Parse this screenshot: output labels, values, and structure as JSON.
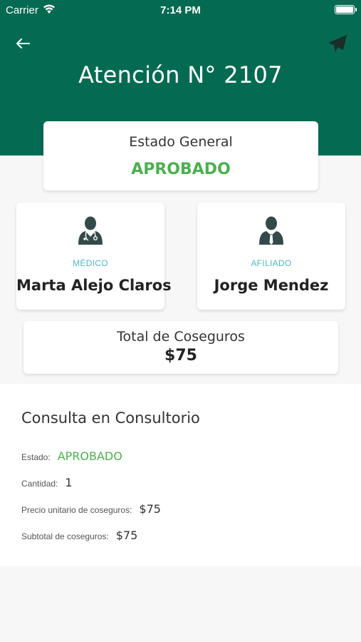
{
  "status_bar": {
    "carrier": "Carrier",
    "time": "7:14 PM",
    "icons": [
      "wifi-icon",
      "battery-icon"
    ]
  },
  "header": {
    "title": "Atención N° 2107",
    "background_color": "#046a52",
    "left_icon": "back-arrow-icon",
    "right_icon": "paper-plane-icon"
  },
  "estado": {
    "label": "Estado General",
    "value": "APROBADO",
    "color": "#4caf50"
  },
  "medico": {
    "role": "MÉDICO",
    "name": "Marta Alejo Claros",
    "icon": "doctor-icon"
  },
  "afiliado": {
    "role": "AFILIADO",
    "name": "Jorge Mendez",
    "icon": "user-icon"
  },
  "coseguros": {
    "label": "Total de Coseguros",
    "value": "$75"
  },
  "detail": {
    "title": "Consulta en Consultorio",
    "rows": [
      {
        "key": "Estado:",
        "value": "APROBADO"
      },
      {
        "key": "Cantidad:",
        "value": "1"
      },
      {
        "key": "Precio unitario de coseguros:",
        "value": "$75"
      },
      {
        "key": "Subtotal de coseguros:",
        "value": "$75"
      }
    ]
  }
}
